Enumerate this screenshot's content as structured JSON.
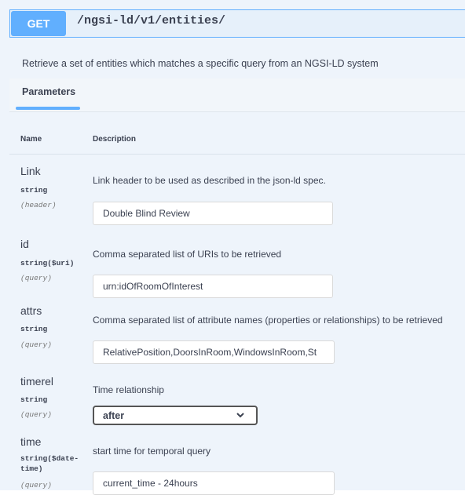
{
  "endpoint": {
    "method": "GET",
    "path": "/ngsi-ld/v1/entities/",
    "description": "Retrieve a set of entities which matches a specific query from an NGSI-LD system"
  },
  "tabs": {
    "parameters": "Parameters"
  },
  "columns": {
    "name": "Name",
    "description": "Description"
  },
  "params": [
    {
      "name": "Link",
      "type": "string",
      "in": "(header)",
      "description": "Link header to be used as described in the json-ld spec.",
      "value": "Double Blind Review"
    },
    {
      "name": "id",
      "type": "string($uri)",
      "in": "(query)",
      "description": "Comma separated list of URIs to be retrieved",
      "value": "urn:idOfRoomOfInterest"
    },
    {
      "name": "attrs",
      "type": "string",
      "in": "(query)",
      "description": "Comma separated list of attribute names (properties or relationships) to be retrieved",
      "value": "RelativePosition,DoorsInRoom,WindowsInRoom,St"
    },
    {
      "name": "timerel",
      "type": "string",
      "in": "(query)",
      "description": "Time relationship",
      "value": "after"
    },
    {
      "name": "time",
      "type_line1": "string($date-",
      "type_line2": "time)",
      "in": "(query)",
      "description": "start time for temporal query",
      "value": "current_time - 24hours"
    }
  ],
  "icons": {
    "select_chevron": "chevron-down-icon"
  },
  "colors": {
    "get": "#61affe",
    "background": "#eef4fb"
  }
}
